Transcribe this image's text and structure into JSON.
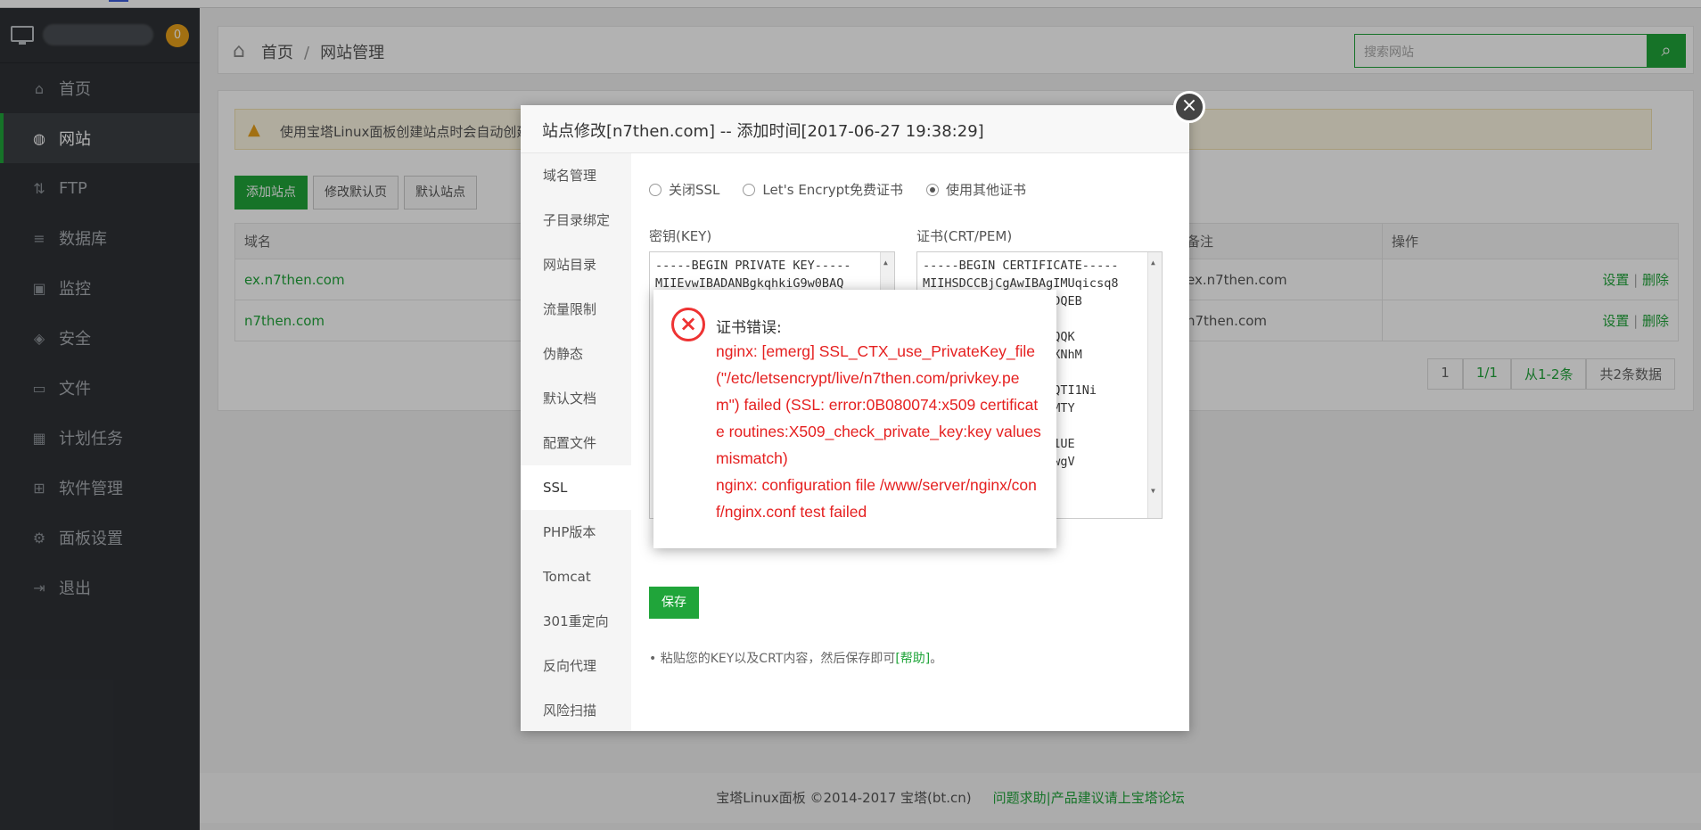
{
  "sidebar": {
    "notify_count": "0",
    "items": [
      {
        "label": "首页",
        "icon": "home-icon"
      },
      {
        "label": "网站",
        "icon": "globe-icon"
      },
      {
        "label": "FTP",
        "icon": "ftp-icon"
      },
      {
        "label": "数据库",
        "icon": "database-icon"
      },
      {
        "label": "监控",
        "icon": "monitor-icon"
      },
      {
        "label": "安全",
        "icon": "shield-icon"
      },
      {
        "label": "文件",
        "icon": "folder-icon"
      },
      {
        "label": "计划任务",
        "icon": "calendar-icon"
      },
      {
        "label": "软件管理",
        "icon": "grid-icon"
      },
      {
        "label": "面板设置",
        "icon": "gear-icon"
      },
      {
        "label": "退出",
        "icon": "logout-icon"
      }
    ]
  },
  "breadcrumb": {
    "home": "首页",
    "sep": "/",
    "current": "网站管理"
  },
  "search": {
    "placeholder": "搜索网站"
  },
  "tip": {
    "text": "使用宝塔Linux面板创建站点时会自动创建"
  },
  "toolbar": {
    "add_site": "添加站点",
    "edit_default": "修改默认页",
    "default_site": "默认站点"
  },
  "table": {
    "headers": {
      "domain": "域名",
      "note": "备注",
      "ops": "操作"
    },
    "rows": [
      {
        "domain": "ex.n7then.com",
        "note": "ex.n7then.com",
        "set": "设置",
        "del": "删除",
        "sep": "|"
      },
      {
        "domain": "n7then.com",
        "note": "n7then.com",
        "set": "设置",
        "del": "删除",
        "sep": "|"
      }
    ]
  },
  "pager": {
    "page": "1",
    "pages": "1/1",
    "range": "从1-2条",
    "total": "共2条数据"
  },
  "footer": {
    "text": "宝塔Linux面板 ©2014-2017 宝塔(bt.cn)",
    "link": "问题求助|产品建议请上宝塔论坛"
  },
  "modal": {
    "title": "站点修改[n7then.com] -- 添加时间[2017-06-27 19:38:29]",
    "tabs": [
      "域名管理",
      "子目录绑定",
      "网站目录",
      "流量限制",
      "伪静态",
      "默认文档",
      "配置文件",
      "SSL",
      "PHP版本",
      "Tomcat",
      "301重定向",
      "反向代理",
      "风险扫描"
    ],
    "active_tab": "SSL",
    "ssl_options": [
      "关闭SSL",
      "Let's Encrypt免费证书",
      "使用其他证书"
    ],
    "selected_option": "使用其他证书",
    "key_label": "密钥(KEY)",
    "cert_label": "证书(CRT/PEM)",
    "key_text": "-----BEGIN PRIVATE KEY-----\nMIIEvwIBADANBgkqhkiG9w0BAQ",
    "cert_text": "-----BEGIN CERTIFICATE-----\nMIIHSDCCBjCgAwIBAgIMUqicsq8\n            qGSIb3DQEB\n\n            wFwYDVQQK\n            uIG52LXNhM\n\n            AtIFNIQTI1Ni\n            YyODAxMTY\n\n            nMB8GA1UE\n            bnRyb2wgV\n            w",
    "save": "保存",
    "help_text": "粘贴您的KEY以及CRT内容，然后保存即可",
    "help_link": "[帮助]",
    "help_end": "。"
  },
  "error": {
    "title": "证书错误:",
    "message_1": "nginx: [emerg] SSL_CTX_use_PrivateKey_file(\"/etc/letsencrypt/live/n7then.com/privkey.pem\") failed (SSL: error:0B080074:x509 certificate routines:X509_check_private_key:key values mismatch)",
    "message_2": "nginx: configuration file /www/server/nginx/conf/nginx.conf test failed"
  }
}
